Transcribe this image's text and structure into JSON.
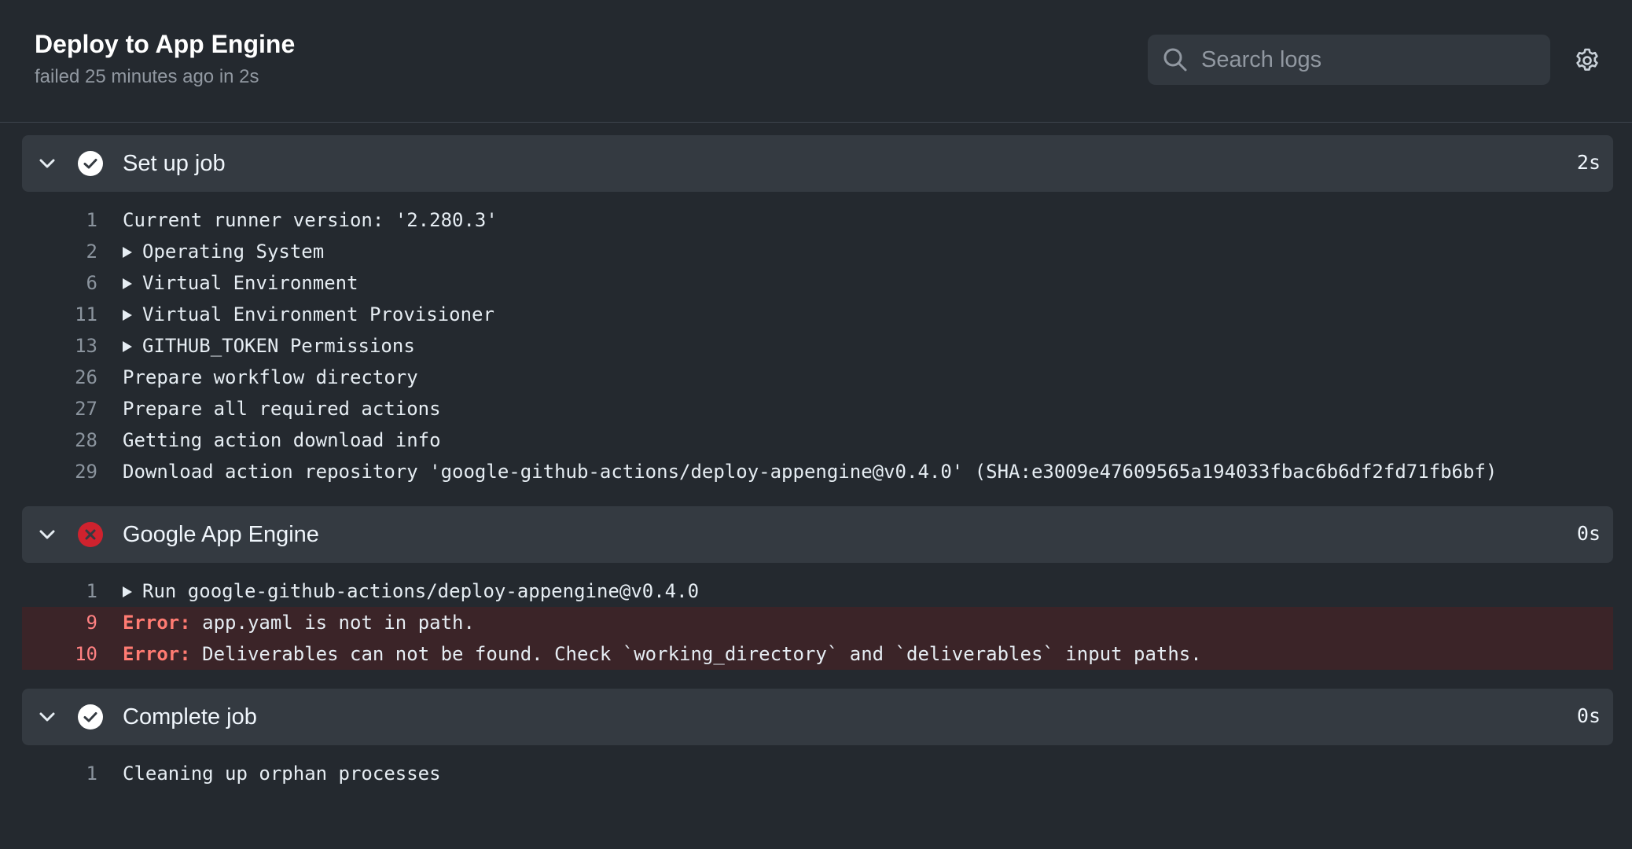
{
  "header": {
    "title": "Deploy to App Engine",
    "subtitle": "failed 25 minutes ago in 2s",
    "search_placeholder": "Search logs"
  },
  "steps": [
    {
      "name": "Set up job",
      "status": "success",
      "duration": "2s",
      "lines": [
        {
          "num": "1",
          "text": "Current runner version: '2.280.3'"
        },
        {
          "num": "2",
          "text": "Operating System",
          "expandable": true
        },
        {
          "num": "6",
          "text": "Virtual Environment",
          "expandable": true
        },
        {
          "num": "11",
          "text": "Virtual Environment Provisioner",
          "expandable": true
        },
        {
          "num": "13",
          "text": "GITHUB_TOKEN Permissions",
          "expandable": true
        },
        {
          "num": "26",
          "text": "Prepare workflow directory"
        },
        {
          "num": "27",
          "text": "Prepare all required actions"
        },
        {
          "num": "28",
          "text": "Getting action download info"
        },
        {
          "num": "29",
          "text": "Download action repository 'google-github-actions/deploy-appengine@v0.4.0' (SHA:e3009e47609565a194033fbac6b6df2fd71fb6bf)"
        }
      ]
    },
    {
      "name": "Google App Engine",
      "status": "failure",
      "duration": "0s",
      "lines": [
        {
          "num": "1",
          "text": "Run google-github-actions/deploy-appengine@v0.4.0",
          "expandable": true
        },
        {
          "num": "9",
          "error_label": "Error:",
          "text": " app.yaml is not in path."
        },
        {
          "num": "10",
          "error_label": "Error:",
          "text": " Deliverables can not be found. Check `working_directory` and `deliverables` input paths."
        }
      ]
    },
    {
      "name": "Complete job",
      "status": "success",
      "duration": "0s",
      "lines": [
        {
          "num": "1",
          "text": "Cleaning up orphan processes"
        }
      ]
    }
  ],
  "colors": {
    "background": "#24292f",
    "step_header": "#343a41",
    "success": "#ffffff",
    "failure": "#cf222e",
    "error_row": "#3b2428",
    "error_text": "#ff7b72"
  },
  "icons": {
    "search": "search-icon",
    "settings": "gear-icon",
    "collapse": "chevron-down-icon",
    "success": "check-circle-icon",
    "failure": "x-circle-icon",
    "expand_group": "triangle-right-icon"
  }
}
